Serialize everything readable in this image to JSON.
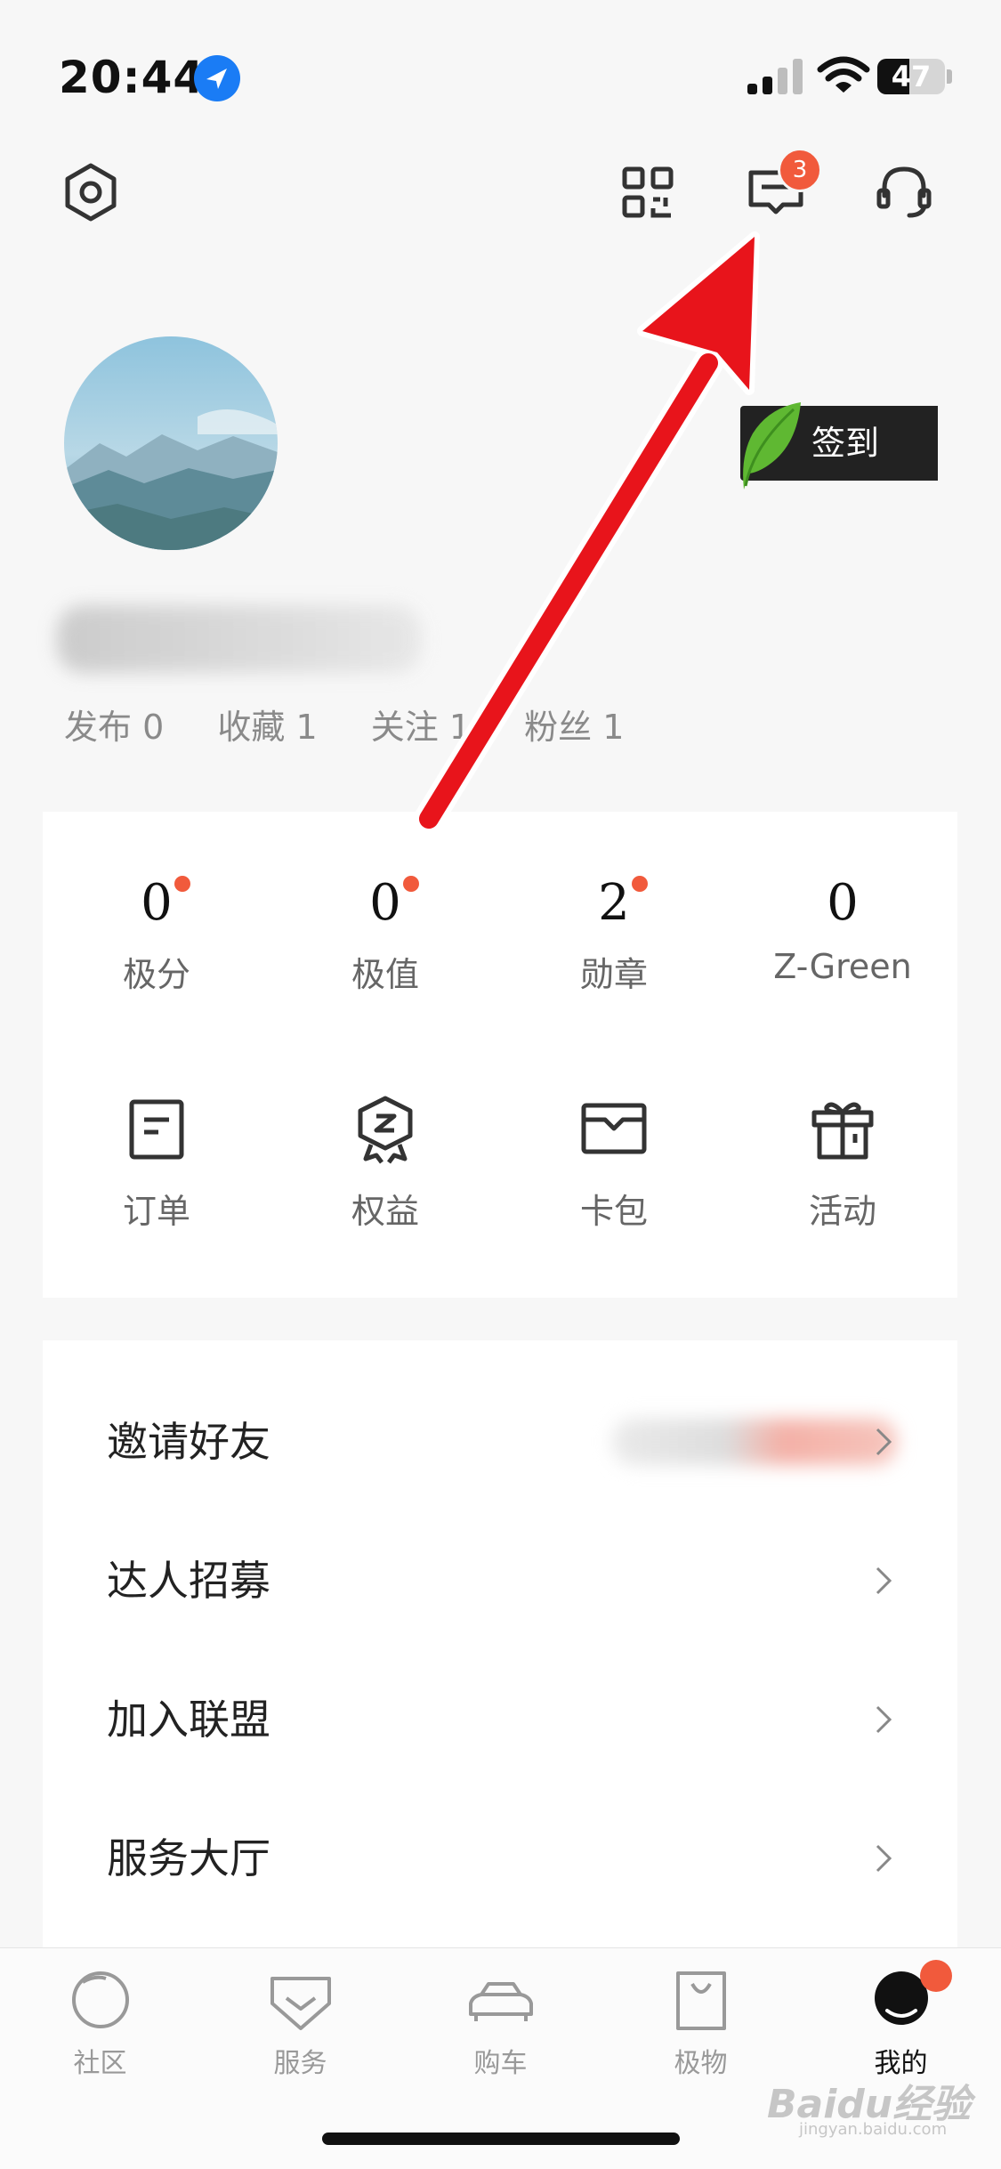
{
  "status_bar": {
    "time": "20:44",
    "battery": "47",
    "battery_level": 0.47
  },
  "header": {
    "icons": [
      "settings-icon",
      "qr-code-icon",
      "message-icon",
      "customer-service-icon"
    ],
    "message_badge": "3"
  },
  "profile": {
    "checkin_label": "签到",
    "stats": [
      {
        "label": "发布",
        "value": "0"
      },
      {
        "label": "收藏",
        "value": "1"
      },
      {
        "label": "关注",
        "value": "1"
      },
      {
        "label": "粉丝",
        "value": "1"
      }
    ]
  },
  "metrics": [
    {
      "value": "0",
      "label": "极分",
      "dot": true
    },
    {
      "value": "0",
      "label": "极值",
      "dot": true
    },
    {
      "value": "2",
      "label": "勋章",
      "dot": true
    },
    {
      "value": "0",
      "label": "Z-Green",
      "dot": false
    }
  ],
  "quick_actions": [
    {
      "label": "订单",
      "icon": "order-icon"
    },
    {
      "label": "权益",
      "icon": "benefits-badge-icon"
    },
    {
      "label": "卡包",
      "icon": "card-wallet-icon"
    },
    {
      "label": "活动",
      "icon": "gift-icon"
    }
  ],
  "menu": [
    {
      "label": "邀请好友"
    },
    {
      "label": "达人招募"
    },
    {
      "label": "加入联盟"
    },
    {
      "label": "服务大厅"
    }
  ],
  "bottom_nav": [
    {
      "label": "社区",
      "icon": "community-icon"
    },
    {
      "label": "服务",
      "icon": "service-icon"
    },
    {
      "label": "购车",
      "icon": "car-icon"
    },
    {
      "label": "极物",
      "icon": "shopping-bag-icon"
    },
    {
      "label": "我的",
      "icon": "profile-icon",
      "active": true
    }
  ],
  "watermark": {
    "main": "Baidu经验",
    "sub": "jingyan.baidu.com"
  },
  "colors": {
    "accent_red": "#f15a3c",
    "location_blue": "#1a7cf5",
    "checkin_bg": "#222222",
    "leaf_green": "#5fb832"
  }
}
